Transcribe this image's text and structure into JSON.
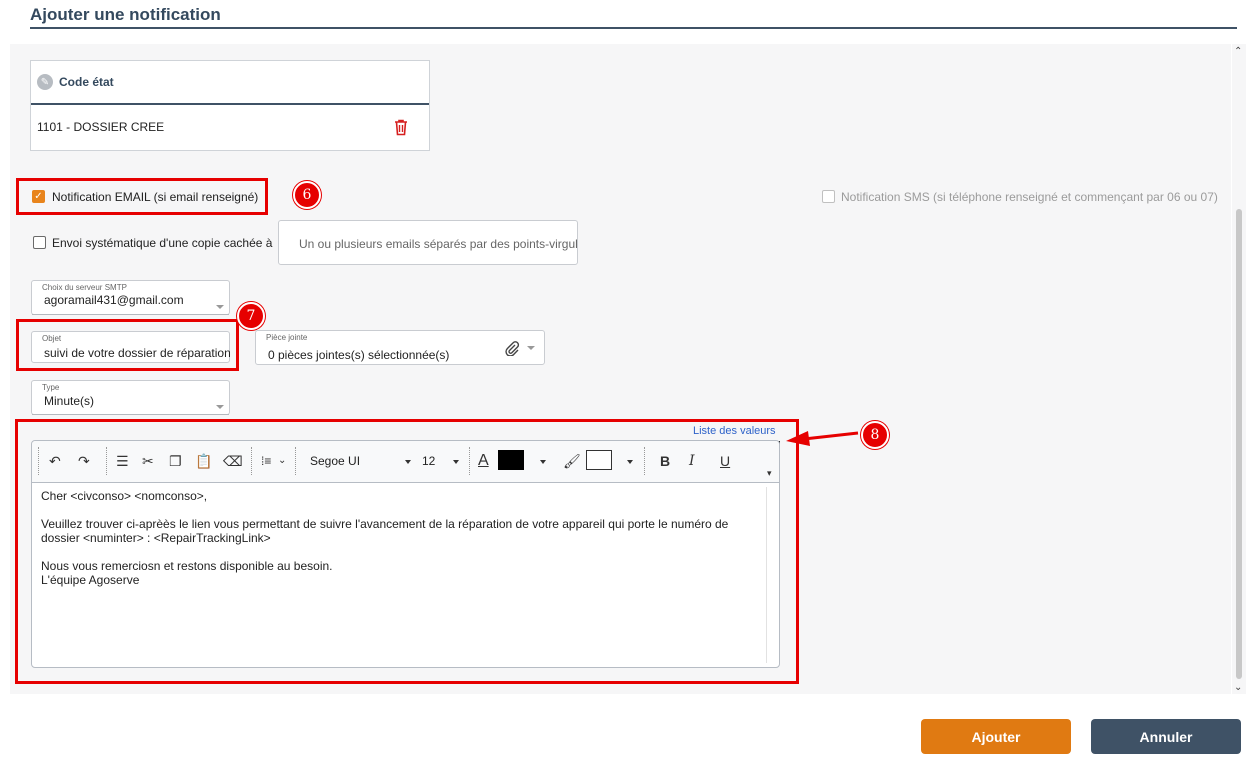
{
  "page": {
    "title": "Ajouter une notification"
  },
  "code_etat": {
    "header": "Code état",
    "value": "1101 - DOSSIER CREE"
  },
  "notifications": {
    "email_label": "Notification EMAIL (si email renseigné)",
    "email_checked": true,
    "sms_label": "Notification SMS (si téléphone renseigné et commençant par 06 ou 07)",
    "sms_checked": false,
    "bcc_label": "Envoi systématique d'une copie cachée à",
    "bcc_checked": false,
    "bcc_placeholder": "Un ou plusieurs emails séparés par des points-virgule"
  },
  "smtp": {
    "label": "Choix du serveur SMTP",
    "value": "agoramail431@gmail.com"
  },
  "objet": {
    "label": "Objet",
    "value": "suivi de votre dossier de réparation"
  },
  "piece_jointe": {
    "label": "Pièce jointe",
    "value": "0 pièces jointes(s) sélectionnée(s)"
  },
  "type": {
    "label": "Type",
    "value": "Minute(s)"
  },
  "liste_valeurs": "Liste des valeurs",
  "editor": {
    "font_name": "Segoe UI",
    "font_size": "12",
    "font_color": "#000000",
    "highlight_color": "#ffffff",
    "lines": [
      "Cher <civconso> <nomconso>,",
      "",
      "Veuillez trouver ci-aprèès le lien vous permettant de suivre l'avancement de la réparation de votre appareil qui porte le numéro de",
      "dossier <numinter>  : <RepairTrackingLink>",
      "",
      "Nous vous remerciosn et restons disponible au besoin.",
      "L'équipe Agoserve"
    ]
  },
  "annotations": {
    "badge_6": "6",
    "badge_7": "7",
    "badge_8": "8"
  },
  "buttons": {
    "add": "Ajouter",
    "cancel": "Annuler"
  },
  "colors": {
    "accent": "#e07a12",
    "primary": "#3f5266",
    "highlight": "#e60000",
    "link": "#2e62c9"
  }
}
